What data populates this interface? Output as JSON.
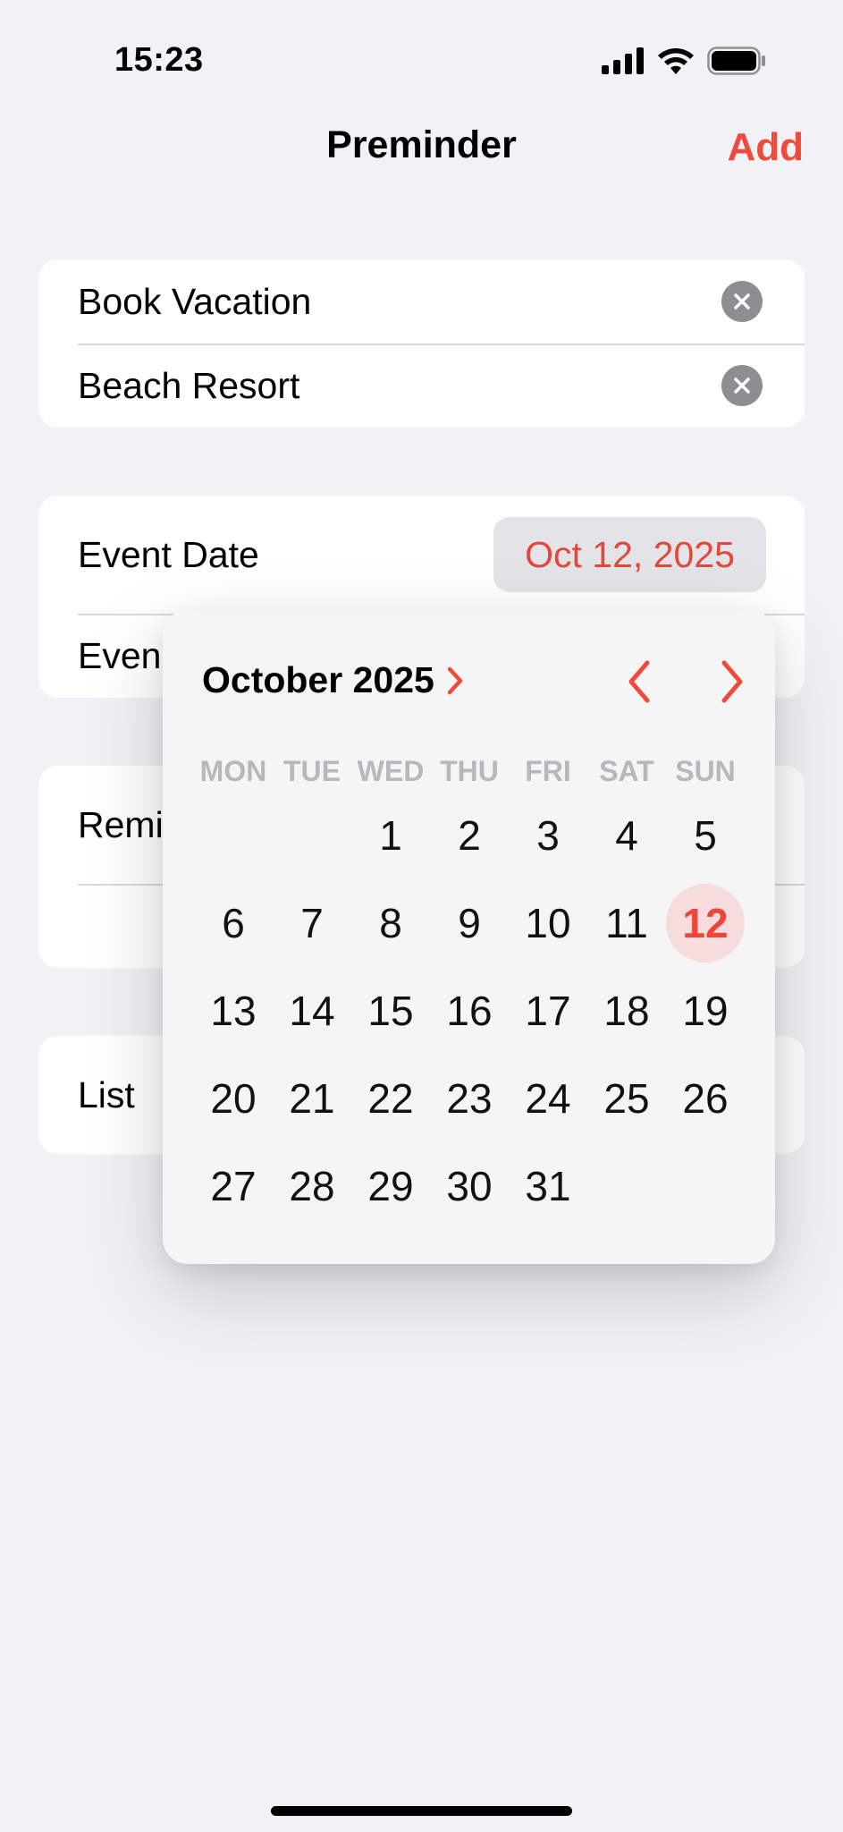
{
  "status": {
    "time": "15:23"
  },
  "nav": {
    "title": "Preminder",
    "add_label": "Add"
  },
  "fields": {
    "title_value": "Book Vacation",
    "notes_value": "Beach Resort"
  },
  "event": {
    "date_label": "Event Date",
    "date_value": "Oct 12, 2025",
    "time_label_partial": "Even"
  },
  "reminder": {
    "label_partial": "Remi"
  },
  "list": {
    "label": "List"
  },
  "calendar": {
    "month_title": "October 2025",
    "weekdays": [
      "MON",
      "TUE",
      "WED",
      "THU",
      "FRI",
      "SAT",
      "SUN"
    ],
    "days": [
      "",
      "",
      "1",
      "2",
      "3",
      "4",
      "5",
      "6",
      "7",
      "8",
      "9",
      "10",
      "11",
      "12",
      "13",
      "14",
      "15",
      "16",
      "17",
      "18",
      "19",
      "20",
      "21",
      "22",
      "23",
      "24",
      "25",
      "26",
      "27",
      "28",
      "29",
      "30",
      "31"
    ],
    "selected_day": "12"
  },
  "colors": {
    "accent": "#f04a3c",
    "selected_bg": "#f6dcdc"
  }
}
